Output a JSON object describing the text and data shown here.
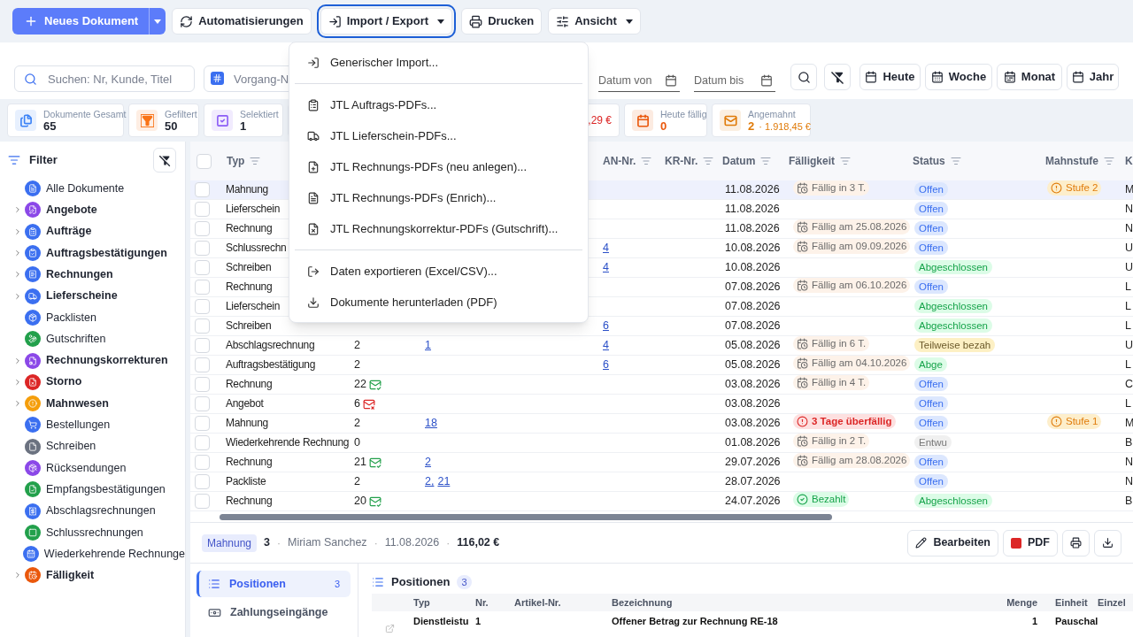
{
  "toolbar": {
    "new_document": {
      "label": "Neues Dokument"
    },
    "buttons": [
      {
        "label": "Automatisierungen",
        "kind": "plain",
        "open": false
      },
      {
        "label": "Import / Export",
        "kind": "menu",
        "open": true
      },
      {
        "label": "Drucken",
        "kind": "plain",
        "open": false
      },
      {
        "label": "Ansicht",
        "kind": "menu",
        "open": false
      }
    ]
  },
  "menu": {
    "groups": [
      [
        "Generischer Import..."
      ],
      [
        "JTL Auftrags-PDFs...",
        "JTL Lieferschein-PDFs...",
        "JTL Rechnungs-PDFs (neu anlegen)...",
        "JTL Rechnungs-PDFs (Enrich)...",
        "JTL Rechnungskorrektur-PDFs (Gutschrift)..."
      ],
      [
        "Daten exportieren (Excel/CSV)...",
        "Dokumente herunterladen (PDF)"
      ]
    ]
  },
  "filters": {
    "search": {
      "placeholder": "Suchen: Nr, Kunde, Titel"
    },
    "number": {
      "placeholder": "Vorgang-N"
    },
    "date_from": {
      "placeholder": "Datum von"
    },
    "date_to": {
      "placeholder": "Datum bis"
    },
    "ranges": [
      "Heute",
      "Woche",
      "Monat",
      "Jahr"
    ]
  },
  "stats": [
    {
      "label": "Dokumente Gesamt",
      "value": "65",
      "kind": "count",
      "color": "#3b82f6"
    },
    {
      "label": "Gefiltert",
      "value": "50",
      "kind": "count",
      "color": "#f97316"
    },
    {
      "label": "Selektiert",
      "value": "1",
      "kind": "count",
      "color": "#8b5cf6"
    },
    {
      "value": ",29 €",
      "kind": "alert",
      "color": "#dc2626"
    },
    {
      "label": "Heute fällig",
      "value": "0",
      "kind": "alert",
      "color": "#ea580c"
    },
    {
      "label": "Angemahnt",
      "value": "2",
      "extra": "· 1.918,45 €",
      "kind": "alert",
      "color": "#e07b0a"
    }
  ],
  "sidebar": {
    "title": "Filter",
    "items": [
      {
        "label": "Alle Dokumente",
        "kind": "item",
        "color": "#3b6ff0"
      },
      {
        "label": "Angebote",
        "kind": "group",
        "color": "#8b48e8"
      },
      {
        "label": "Aufträge",
        "kind": "group",
        "color": "#3b6ff0"
      },
      {
        "label": "Auftragsbestätigungen",
        "kind": "group",
        "color": "#3b6ff0"
      },
      {
        "label": "Rechnungen",
        "kind": "group",
        "color": "#3b6ff0"
      },
      {
        "label": "Lieferscheine",
        "kind": "group",
        "color": "#3b6ff0"
      },
      {
        "label": "Packlisten",
        "kind": "item",
        "color": "#3b6ff0"
      },
      {
        "label": "Gutschriften",
        "kind": "item",
        "color": "#22a04b"
      },
      {
        "label": "Rechnungskorrekturen",
        "kind": "group",
        "color": "#8b48e8"
      },
      {
        "label": "Storno",
        "kind": "group",
        "color": "#dc2626"
      },
      {
        "label": "Mahnwesen",
        "kind": "group",
        "color": "#f59e0b"
      },
      {
        "label": "Bestellungen",
        "kind": "item",
        "color": "#3b6ff0"
      },
      {
        "label": "Schreiben",
        "kind": "item",
        "color": "#6b7280"
      },
      {
        "label": "Rücksendungen",
        "kind": "item",
        "color": "#8b48e8"
      },
      {
        "label": "Empfangsbestätigungen",
        "kind": "item",
        "color": "#22a04b"
      },
      {
        "label": "Abschlagsrechnungen",
        "kind": "item",
        "color": "#3b6ff0"
      },
      {
        "label": "Schlussrechnungen",
        "kind": "item",
        "color": "#22a04b"
      },
      {
        "label": "Wiederkehrende Rechnunge",
        "kind": "item",
        "color": "#3b6ff0"
      },
      {
        "label": "Fälligkeit",
        "kind": "group",
        "color": "#ea580c"
      }
    ]
  },
  "table": {
    "columns": [
      {
        "label": "Typ",
        "filterable": true
      },
      {
        "label": "AN-Nr.",
        "filterable": true
      },
      {
        "label": "KR-Nr.",
        "filterable": true
      },
      {
        "label": "Datum",
        "filterable": true
      },
      {
        "label": "Fälligkeit",
        "filterable": true
      },
      {
        "label": "Status",
        "filterable": true
      },
      {
        "label": "Mahnstufe",
        "filterable": true
      },
      {
        "label": "K",
        "filterable": false
      }
    ],
    "header_checked": false,
    "rows": [
      {
        "selected": true,
        "checked": false,
        "type": "Mahnung",
        "date": "11.08.2026",
        "due": {
          "kind": "due",
          "text": "Fällig in 3 T."
        },
        "status": {
          "kind": "open",
          "text": "Offen"
        },
        "dunning": "Stufe 2",
        "customer": "M"
      },
      {
        "selected": false,
        "checked": false,
        "type": "Lieferschein",
        "date": "11.08.2026",
        "status": {
          "kind": "open",
          "text": "Offen"
        },
        "customer": "N"
      },
      {
        "selected": false,
        "checked": false,
        "type": "Rechnung",
        "date": "11.08.2026",
        "due": {
          "kind": "due",
          "text": "Fällig am 25.08.2026"
        },
        "status": {
          "kind": "open",
          "text": "Offen"
        },
        "customer": "N"
      },
      {
        "selected": false,
        "checked": false,
        "type": "Schlussrechn",
        "an": "4",
        "date": "10.08.2026",
        "due": {
          "kind": "due",
          "text": "Fällig am 09.09.2026"
        },
        "status": {
          "kind": "open",
          "text": "Offen"
        },
        "customer": "U"
      },
      {
        "selected": false,
        "checked": false,
        "type": "Schreiben",
        "an": "4",
        "date": "10.08.2026",
        "status": {
          "kind": "closed",
          "text": "Abgeschlossen"
        },
        "customer": "U"
      },
      {
        "selected": false,
        "checked": false,
        "type": "Rechnung",
        "date": "07.08.2026",
        "due": {
          "kind": "due",
          "text": "Fällig am 06.10.2026"
        },
        "status": {
          "kind": "open",
          "text": "Offen"
        },
        "customer": "L"
      },
      {
        "selected": false,
        "checked": false,
        "type": "Lieferschein",
        "date": "07.08.2026",
        "status": {
          "kind": "closed",
          "text": "Abgeschlossen"
        },
        "customer": "L"
      },
      {
        "selected": false,
        "checked": false,
        "type": "Schreiben",
        "an": "6",
        "date": "07.08.2026",
        "status": {
          "kind": "closed",
          "text": "Abgeschlossen"
        },
        "customer": "L"
      },
      {
        "selected": false,
        "checked": false,
        "type": "Abschlagsrechnung",
        "nr": "2",
        "refs": [
          "1"
        ],
        "an": "4",
        "date": "05.08.2026",
        "due": {
          "kind": "due",
          "text": "Fällig in 6 T."
        },
        "status": {
          "kind": "partial",
          "text": "Teilweise bezah"
        },
        "customer": "U"
      },
      {
        "selected": false,
        "checked": false,
        "type": "Auftragsbestätigung",
        "nr": "2",
        "an": "6",
        "date": "05.08.2026",
        "due": {
          "kind": "due",
          "text": "Fällig am 04.10.2026"
        },
        "status": {
          "kind": "closed",
          "text": "Abge"
        },
        "customer": "L"
      },
      {
        "selected": false,
        "checked": false,
        "type": "Rechnung",
        "nr": "22",
        "mail": {
          "kind": "sent"
        },
        "date": "03.08.2026",
        "due": {
          "kind": "due",
          "text": "Fällig in 4 T."
        },
        "status": {
          "kind": "open",
          "text": "Offen"
        },
        "customer": "C"
      },
      {
        "selected": false,
        "checked": false,
        "type": "Angebot",
        "nr": "6",
        "mail": {
          "kind": "failed"
        },
        "date": "03.08.2026",
        "status": {
          "kind": "open",
          "text": "Offen"
        },
        "customer": "L"
      },
      {
        "selected": false,
        "checked": false,
        "type": "Mahnung",
        "nr": "2",
        "refs": [
          "18"
        ],
        "date": "03.08.2026",
        "due": {
          "kind": "overdue",
          "text": "3 Tage überfällig"
        },
        "status": {
          "kind": "open",
          "text": "Offen"
        },
        "dunning": "Stufe 1",
        "customer": "M"
      },
      {
        "selected": false,
        "checked": false,
        "type": "Wiederkehrende Rechnung",
        "nr": "0",
        "date": "01.08.2026",
        "due": {
          "kind": "due",
          "text": "Fällig in 2 T."
        },
        "status": {
          "kind": "draft",
          "text": "Entwu"
        },
        "customer": "B"
      },
      {
        "selected": false,
        "checked": false,
        "type": "Rechnung",
        "nr": "21",
        "mail": {
          "kind": "sent"
        },
        "refs": [
          "2"
        ],
        "date": "29.07.2026",
        "due": {
          "kind": "due",
          "text": "Fällig am 28.08.2026"
        },
        "status": {
          "kind": "open",
          "text": "Offen"
        },
        "customer": "N"
      },
      {
        "selected": false,
        "checked": false,
        "type": "Packliste",
        "nr": "2",
        "refs": [
          "2,",
          "21"
        ],
        "date": "28.07.2026",
        "status": {
          "kind": "open",
          "text": "Offen"
        },
        "customer": "N"
      },
      {
        "selected": false,
        "checked": false,
        "type": "Rechnung",
        "nr": "20",
        "mail": {
          "kind": "sent"
        },
        "date": "24.07.2026",
        "due": {
          "kind": "paid",
          "text": "Bezahlt"
        },
        "status": {
          "kind": "closed",
          "text": "Abgeschlossen"
        },
        "customer": "B"
      }
    ]
  },
  "detail": {
    "type": "Mahnung",
    "meta": [
      {
        "kind": "number",
        "text": "3"
      },
      {
        "kind": "sep",
        "text": "·"
      },
      {
        "kind": "plain",
        "text": "Miriam Sanchez"
      },
      {
        "kind": "sep",
        "text": "·"
      },
      {
        "kind": "plain",
        "text": "11.08.2026"
      },
      {
        "kind": "sep",
        "text": "·"
      },
      {
        "kind": "number",
        "text": "116,02 €"
      }
    ],
    "actions": [
      {
        "kind": "edit",
        "label": "Bearbeiten"
      },
      {
        "kind": "pdf",
        "label": "PDF"
      },
      {
        "kind": "print"
      },
      {
        "kind": "download"
      }
    ],
    "tabs": [
      {
        "label": "Positionen",
        "count": "3",
        "selected": true
      },
      {
        "label": "Zahlungseingänge",
        "selected": false
      }
    ],
    "positions": {
      "title": "Positionen",
      "count": "3",
      "columns": [
        "Typ",
        "Nr.",
        "Artikel-Nr.",
        "Bezeichnung",
        "Menge",
        "Einheit",
        "Einzel"
      ],
      "rows": [
        {
          "type": "Dienstleistu",
          "nr": "1",
          "name": "Offener Betrag zur Rechnung RE-18",
          "qty": "1",
          "unit": "Pauschal"
        }
      ]
    }
  }
}
